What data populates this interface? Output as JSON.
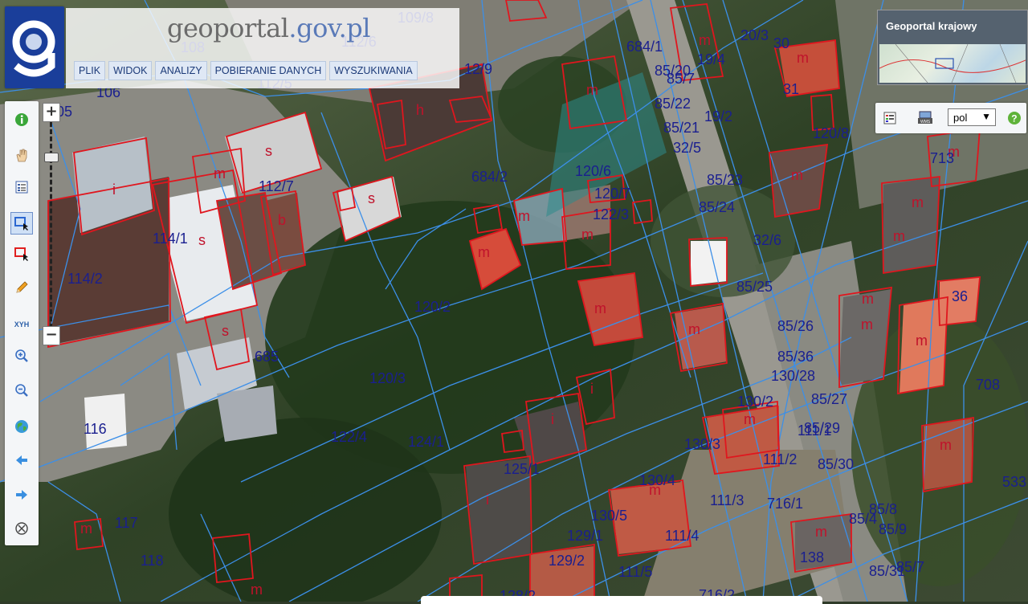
{
  "brand": {
    "name_part1": "geo",
    "name_part2": "portal",
    "name_part3": ".gov.pl"
  },
  "menu": [
    "PLIK",
    "WIDOK",
    "ANALIZY",
    "POBIERANIE DANYCH",
    "WYSZUKIWANIA"
  ],
  "overview": {
    "title": "Geoportal krajowy"
  },
  "language": {
    "selected": "pol"
  },
  "toolbar_icons": [
    "info-icon",
    "pan-hand-icon",
    "legend-icon",
    "select-box-icon",
    "select-red-icon",
    "pencil-icon",
    "xyh-icon",
    "zoom-in-icon",
    "zoom-out-icon",
    "globe-icon",
    "back-arrow-icon",
    "forward-arrow-icon",
    "close-circle-icon"
  ],
  "toolbar_xyh": "XYH",
  "zoom": {
    "plus": "+",
    "minus": "−"
  },
  "parcel_labels": [
    "106",
    "108",
    "109/8",
    "112/5",
    "112/6",
    "12/9",
    "684/1",
    "85/20",
    "85/7",
    "19/4",
    "20/3",
    "30",
    "31",
    "19/2",
    "85/21",
    "85/22",
    "120/8",
    "32/5",
    "684/2",
    "120/6",
    "120/7",
    "122/3",
    "85/23",
    "85/24",
    "713",
    "112/7",
    "114/1",
    "114/2",
    "32/6",
    "85/25",
    "120/2",
    "36",
    "85/26",
    "85/36",
    "130/28",
    "708",
    "685",
    "120/3",
    "85/27",
    "130/2",
    "122/4",
    "124/1",
    "116",
    "130/3",
    "111/1",
    "85/29",
    "111/2",
    "85/30",
    "125/1",
    "130/4",
    "111/3",
    "716/1",
    "533",
    "117",
    "130/5",
    "129/1",
    "111/4",
    "85/8",
    "85/9",
    "85/4",
    "138",
    "118",
    "129/2",
    "111/5",
    "128/2",
    "716/2",
    "85/31",
    "85/7",
    "05"
  ],
  "building_labels": [
    "h",
    "m",
    "s",
    "s",
    "b",
    "m",
    "i",
    "s",
    "s",
    "m",
    "m",
    "m",
    "m",
    "m",
    "m",
    "m",
    "m",
    "m",
    "m",
    "m",
    "m",
    "m",
    "i",
    "m",
    "m",
    "i",
    "m",
    "m",
    "m",
    "m",
    "m",
    "m"
  ]
}
